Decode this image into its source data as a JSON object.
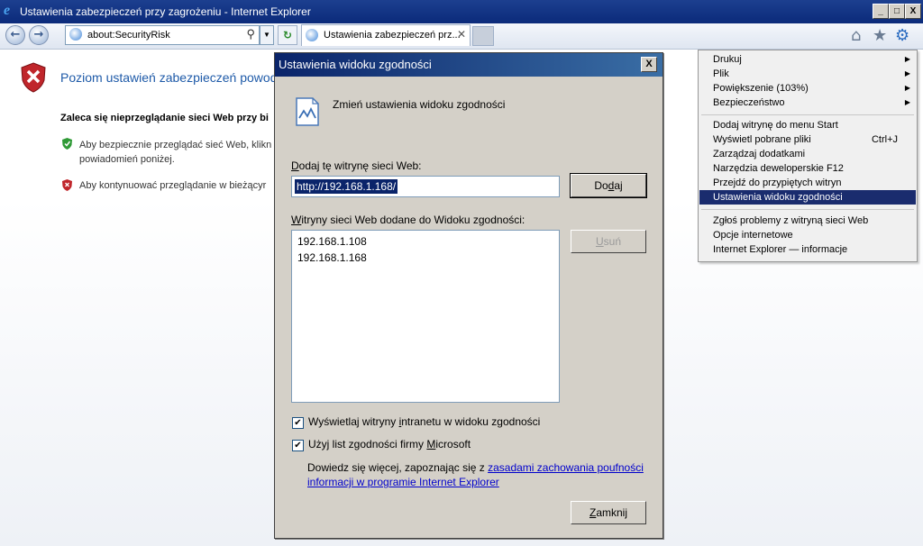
{
  "window": {
    "title": "Ustawienia zabezpieczeń przy zagrożeniu - Internet Explorer",
    "min": "_",
    "max": "□",
    "close": "X"
  },
  "toolbar": {
    "address": "about:SecurityRisk",
    "tab_label": "Ustawienia zabezpieczeń prz...",
    "tab_close": "✕"
  },
  "content": {
    "heading": "Poziom ustawień zabezpieczeń powod",
    "recommend": "Zaleca się nieprzeglądanie sieci Web przy bi",
    "option1": "Aby bezpiecznie przeglądać sieć Web, klikn powiadomień poniżej.",
    "option2": "Aby kontynuować przeglądanie w bieżącyr"
  },
  "dialog": {
    "title": "Ustawienia widoku zgodności",
    "close": "X",
    "heading": "Zmień ustawienia widoku zgodności",
    "add_label_pre": "D",
    "add_label_rest": "odaj tę witrynę sieci Web:",
    "input_value": "http://192.168.1.168/",
    "add_button_pre": "Do",
    "add_button_u": "d",
    "add_button_post": "aj",
    "list_label_pre": "W",
    "list_label_rest": "itryny sieci Web dodane do Widoku zgodności:",
    "remove_button_pre": "U",
    "remove_button_rest": "suń",
    "sites": [
      "192.168.1.108",
      "192.168.1.168"
    ],
    "check1_pre": "Wyświetlaj witryny ",
    "check1_u": "i",
    "check1_post": "ntranetu w widoku zgodności",
    "check2_pre": "Użyj list zgodności firmy ",
    "check2_u": "M",
    "check2_post": "icrosoft",
    "info_text": "Dowiedz się więcej, zapoznając się z ",
    "info_link": "zasadami zachowania poufności informacji w programie Internet Explorer",
    "close_button_pre": "Z",
    "close_button_rest": "amknij"
  },
  "menu": {
    "items": [
      {
        "label": "Drukuj",
        "shortcut": ""
      },
      {
        "label": "Plik",
        "shortcut": ""
      },
      {
        "label": "Powiększenie (103%)",
        "shortcut": ""
      },
      {
        "label": "Bezpieczeństwo",
        "shortcut": ""
      },
      {
        "label": "Dodaj witrynę do menu Start",
        "shortcut": ""
      },
      {
        "label": "Wyświetl pobrane pliki",
        "shortcut": "Ctrl+J"
      },
      {
        "label": "Zarządzaj dodatkami",
        "shortcut": ""
      },
      {
        "label": "Narzędzia deweloperskie F12",
        "shortcut": ""
      },
      {
        "label": "Przejdź do przypiętych witryn",
        "shortcut": ""
      },
      {
        "label": "Ustawienia widoku zgodności",
        "shortcut": ""
      },
      {
        "label": "Zgłoś problemy z witryną sieci Web",
        "shortcut": ""
      },
      {
        "label": "Opcje internetowe",
        "shortcut": ""
      },
      {
        "label": "Internet Explorer — informacje",
        "shortcut": ""
      }
    ]
  },
  "colors": {
    "title_bar": "#0b2a7a",
    "menu_highlight": "#1a2c6e",
    "heading": "#1e5aa8"
  }
}
